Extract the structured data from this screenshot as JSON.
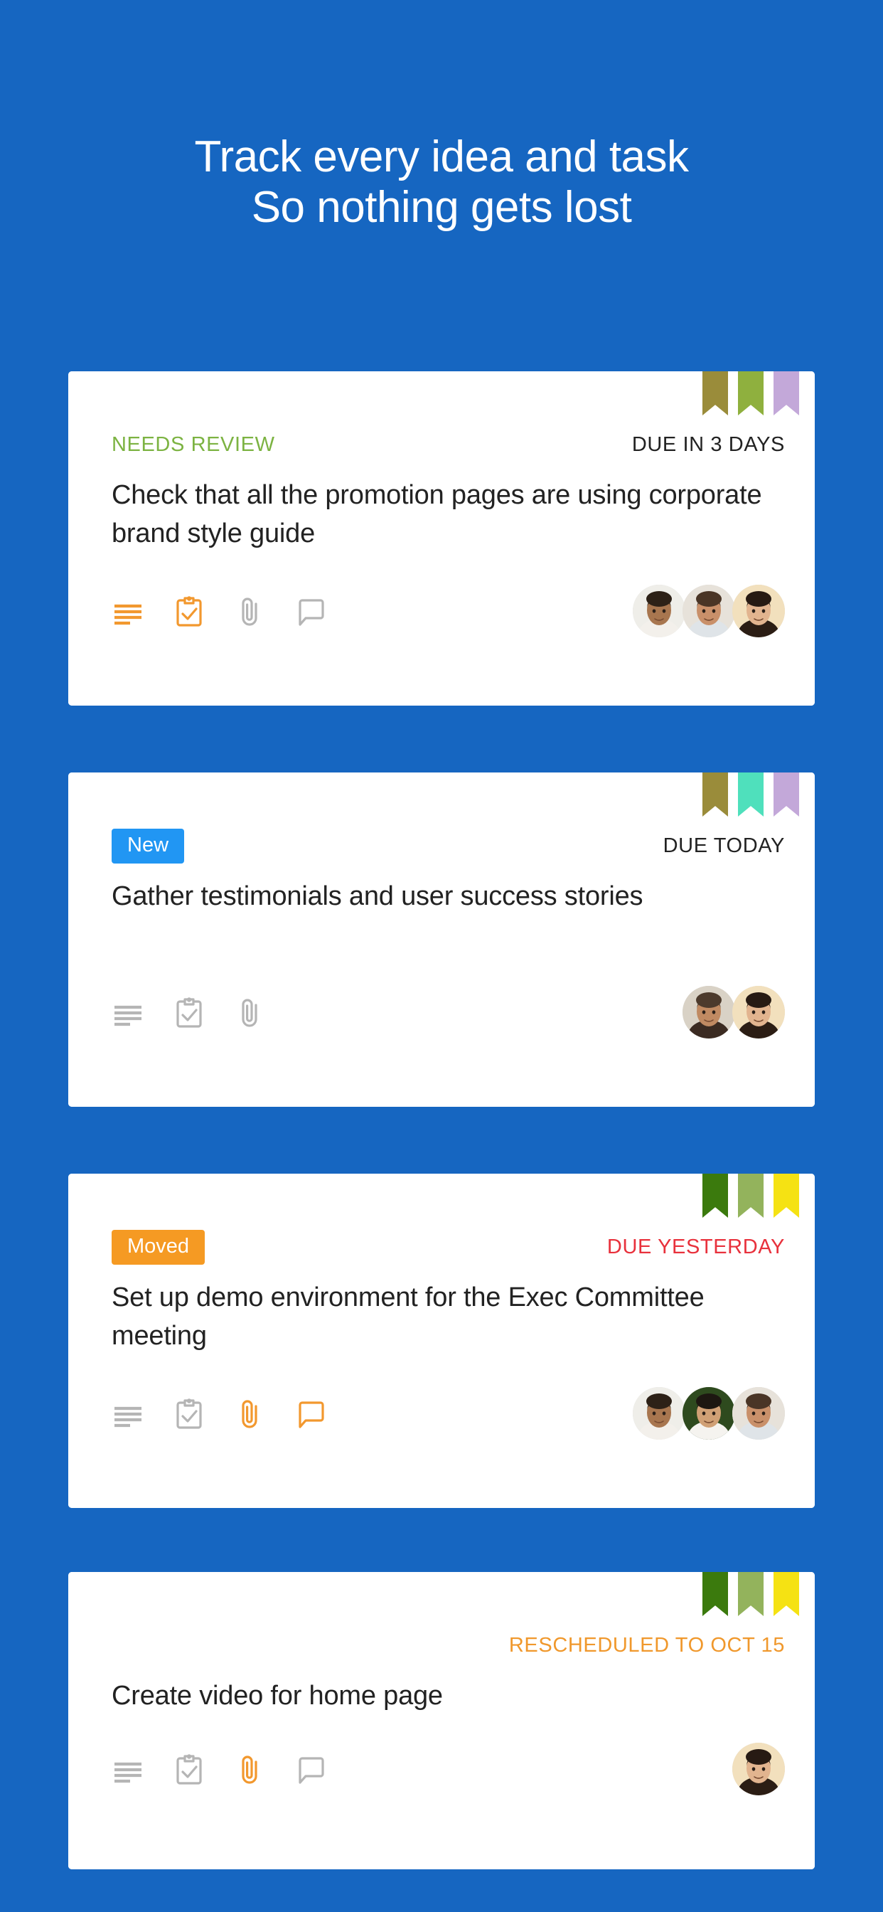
{
  "page": {
    "background_color": "#1666c1",
    "headline_lines": [
      "Track every idea and task",
      "So nothing gets lost"
    ]
  },
  "colors": {
    "brand_blue": "#1666c1",
    "badge_new_blue": "#2196f3",
    "badge_moved_orange": "#f59a23",
    "status_green": "#7cb342",
    "due_red": "#e8313c",
    "due_dark": "#222222",
    "rescheduled_orange": "#f0982c",
    "icon_active_orange": "#f2982e",
    "icon_inactive_gray": "#b5b5b5",
    "card_white": "#ffffff"
  },
  "cards": [
    {
      "id": "card-needs-review",
      "status": {
        "label": "NEEDS REVIEW",
        "style": "text",
        "color": "#7cb342"
      },
      "due": {
        "label": "DUE IN 3 DAYS",
        "color": "#222222"
      },
      "title": "Check that all the promotion pages are using corporate brand style guide",
      "flags": [
        "#9a8c3a",
        "#8fb03e",
        "#c3a8d9"
      ],
      "icons": [
        {
          "name": "description-icon",
          "state": "active"
        },
        {
          "name": "checklist-icon",
          "state": "active"
        },
        {
          "name": "attachment-icon",
          "state": "inactive"
        },
        {
          "name": "comment-icon",
          "state": "inactive"
        }
      ],
      "avatars": [
        {
          "name": "avatar-man-glasses-suit",
          "skin": "#a8764f",
          "hair": "#2d2117",
          "shirt": "#f3f0eb",
          "bg": "#efeee9"
        },
        {
          "name": "avatar-man-dark-hair",
          "skin": "#c9906a",
          "hair": "#4a3526",
          "shirt": "#dfe4e8",
          "bg": "#e7e2da"
        },
        {
          "name": "avatar-woman-long-hair",
          "skin": "#e2b48f",
          "hair": "#271a13",
          "shirt": "#2b1d14",
          "bg": "#f2e0bd"
        }
      ]
    },
    {
      "id": "card-new",
      "status": {
        "label": "New",
        "style": "badge",
        "color": "#2196f3"
      },
      "due": {
        "label": "DUE TODAY",
        "color": "#222222"
      },
      "title": "Gather testimonials and user success stories",
      "flags": [
        "#9a8c3a",
        "#4fe0bc",
        "#c3a8d9"
      ],
      "icons": [
        {
          "name": "description-icon",
          "state": "inactive"
        },
        {
          "name": "checklist-icon",
          "state": "inactive"
        },
        {
          "name": "attachment-icon",
          "state": "inactive"
        }
      ],
      "avatars": [
        {
          "name": "avatar-man-bald",
          "skin": "#c08a62",
          "hair": "#4c3a2c",
          "shirt": "#3b2b22",
          "bg": "#d9d2c6"
        },
        {
          "name": "avatar-woman-long-hair",
          "skin": "#e2b48f",
          "hair": "#271a13",
          "shirt": "#2b1d14",
          "bg": "#f2e0bd"
        }
      ]
    },
    {
      "id": "card-moved",
      "status": {
        "label": "Moved",
        "style": "badge",
        "color": "#f59a23"
      },
      "due": {
        "label": "DUE YESTERDAY",
        "color": "#e8313c"
      },
      "title": "Set up demo environment for the Exec Committee meeting",
      "flags": [
        "#3b7a0d",
        "#93b35c",
        "#f5e213"
      ],
      "icons": [
        {
          "name": "description-icon",
          "state": "inactive"
        },
        {
          "name": "checklist-icon",
          "state": "inactive"
        },
        {
          "name": "attachment-icon",
          "state": "active"
        },
        {
          "name": "comment-icon",
          "state": "active"
        }
      ],
      "avatars": [
        {
          "name": "avatar-man-glasses-suit",
          "skin": "#a8764f",
          "hair": "#2d2117",
          "shirt": "#f3f0eb",
          "bg": "#efeee9"
        },
        {
          "name": "avatar-man-smiling-suit",
          "skin": "#d0a075",
          "hair": "#1d1711",
          "shirt": "#f5f3ef",
          "bg": "#2e4a1e"
        },
        {
          "name": "avatar-man-dark-hair",
          "skin": "#c9906a",
          "hair": "#4a3526",
          "shirt": "#dfe4e8",
          "bg": "#e7e2da"
        }
      ]
    },
    {
      "id": "card-rescheduled",
      "status": {
        "label": "",
        "style": "none",
        "color": "#ffffff"
      },
      "due": {
        "label": "RESCHEDULED TO OCT 15",
        "color": "#f0982c"
      },
      "title": "Create video for home page",
      "flags": [
        "#3b7a0d",
        "#93b35c",
        "#f5e213"
      ],
      "icons": [
        {
          "name": "description-icon",
          "state": "inactive"
        },
        {
          "name": "checklist-icon",
          "state": "inactive"
        },
        {
          "name": "attachment-icon",
          "state": "active"
        },
        {
          "name": "comment-icon",
          "state": "inactive"
        }
      ],
      "avatars": [
        {
          "name": "avatar-woman-long-hair",
          "skin": "#e2b48f",
          "hair": "#271a13",
          "shirt": "#2b1d14",
          "bg": "#f2e0bd"
        }
      ]
    }
  ]
}
